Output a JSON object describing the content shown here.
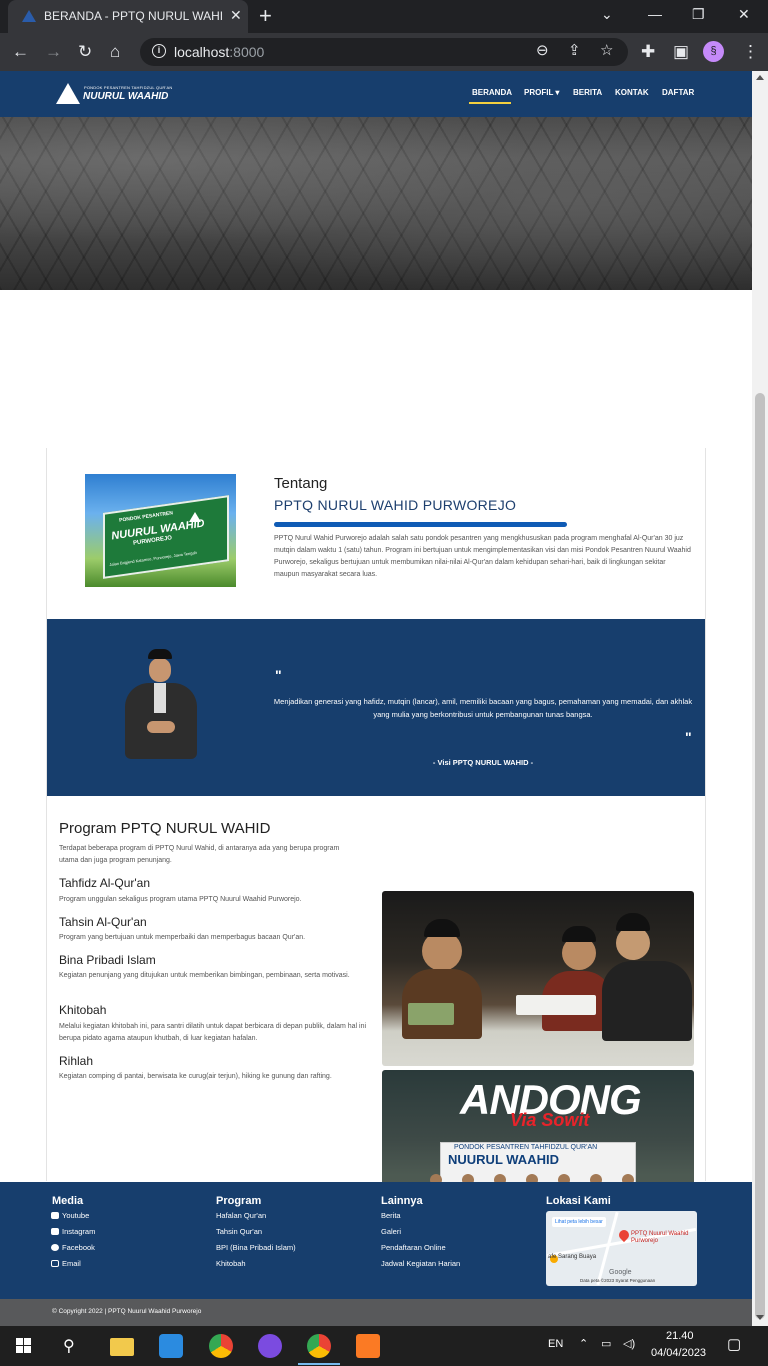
{
  "browser": {
    "tab_title": "BERANDA - PPTQ NURUL WAHID",
    "tab_close": "✕",
    "new_tab": "+",
    "url_host": "localhost",
    "url_port": ":8000",
    "window_controls": [
      "⌄",
      "—",
      "❐",
      "✕"
    ],
    "profile_initial": "§"
  },
  "navbar": {
    "logo_small": "PONDOK PESANTREN TAHFIDZUL QUR'AN",
    "logo_big": "NUURUL WAAHID",
    "items": [
      {
        "label": "BERANDA"
      },
      {
        "label": "PROFIL ▾"
      },
      {
        "label": "BERITA"
      },
      {
        "label": "KONTAK"
      },
      {
        "label": "DAFTAR"
      }
    ]
  },
  "about": {
    "sign_line1": "PONDOK PESANTREN",
    "sign_line2": "NUURUL WAAHID",
    "sign_line3": "PURWOREJO",
    "sign_line4": "Jalan Brigjend Katamso, Purworejo, Jawa Tengah",
    "heading": "Tentang",
    "subheading": "PPTQ NURUL WAHID PURWOREJO",
    "text": "PPTQ Nurul Wahid Purworejo adalah salah satu pondok pesantren yang mengkhususkan pada program menghafal Al-Qur'an 30 juz mutqin dalam waktu 1 (satu) tahun. Program ini bertujuan untuk mengimplementasikan visi dan misi Pondok Pesantren Nuurul Waahid Purworejo, sekaligus bertujuan untuk membumikan nilai-nilai Al-Qur'an dalam kehidupan sehari-hari, baik di lingkungan sekitar maupun masyarakat secara luas."
  },
  "vision": {
    "open_quote": "\"",
    "close_quote": "\"",
    "text": "Menjadikan generasi yang hafidz, mutqin (lancar), amil, memiliki bacaan yang bagus, pemahaman yang memadai, dan akhlak yang mulia yang berkontribusi untuk pembangunan tunas bangsa.",
    "signature": "- Visi PPTQ NURUL WAHID -"
  },
  "programs": {
    "title": "Program PPTQ NURUL WAHID",
    "intro": "Terdapat beberapa program di PPTQ Nurul Wahid, di antaranya ada yang berupa program utama dan juga program penunjang.",
    "items": [
      {
        "name": "Tahfidz Al-Qur'an",
        "desc": "Program unggulan sekaligus program utama PPTQ Nuurul Waahid Purworejo."
      },
      {
        "name": "Tahsin Al-Qur'an",
        "desc": "Program yang bertujuan untuk memperbaiki dan memperbagus bacaan Qur'an."
      },
      {
        "name": "Bina Pribadi Islam",
        "desc": "Kegiatan penunjang yang ditujukan untuk memberikan bimbingan, pembinaan, serta motivasi."
      },
      {
        "name": "Khitobah",
        "desc": "Melalui kegiatan khitobah ini, para santri dilatih untuk dapat berbicara di depan publik, dalam hal ini berupa pidato agama ataupun khutbah, di luar kegiatan hafalan."
      },
      {
        "name": "Rihlah",
        "desc": "Kegiatan comping di pantai, berwisata ke curug(air terjun), hiking ke gunung dan rafting."
      }
    ],
    "photo2_title": "ANDONG",
    "photo2_subtitle": "Via Sowit",
    "photo2_banner": "NUURUL WAAHID",
    "photo2_banner_small": "PONDOK PESANTREN TAHFIDZUL QUR'AN"
  },
  "footer": {
    "media_heading": "Media",
    "media_links": [
      "Youtube",
      "Instagram",
      "Facebook",
      "Email"
    ],
    "program_heading": "Program",
    "program_links": [
      "Hafalan Qur'an",
      "Tahsin Qur'an",
      "BPI (Bina Pribadi Islam)",
      "Khitobah"
    ],
    "other_heading": "Lainnya",
    "other_links": [
      "Berita",
      "Galeri",
      "Pendaftaran Online",
      "Jadwal Kegiatan Harian"
    ],
    "location_heading": "Lokasi Kami",
    "map_link": "Lihat peta lebih besar",
    "map_place": "PPTQ Nuurul Waahid Purworejo",
    "map_place2": "afe Sarang Buaya",
    "map_google": "Google",
    "map_credit": "Data peta ©2023   Syarat Penggunaan",
    "copyright": "© Copyright 2022 | PPTQ Nuurul Waahid Purworejo"
  },
  "taskbar": {
    "language": "EN",
    "time": "21.40",
    "date": "04/04/2023"
  }
}
